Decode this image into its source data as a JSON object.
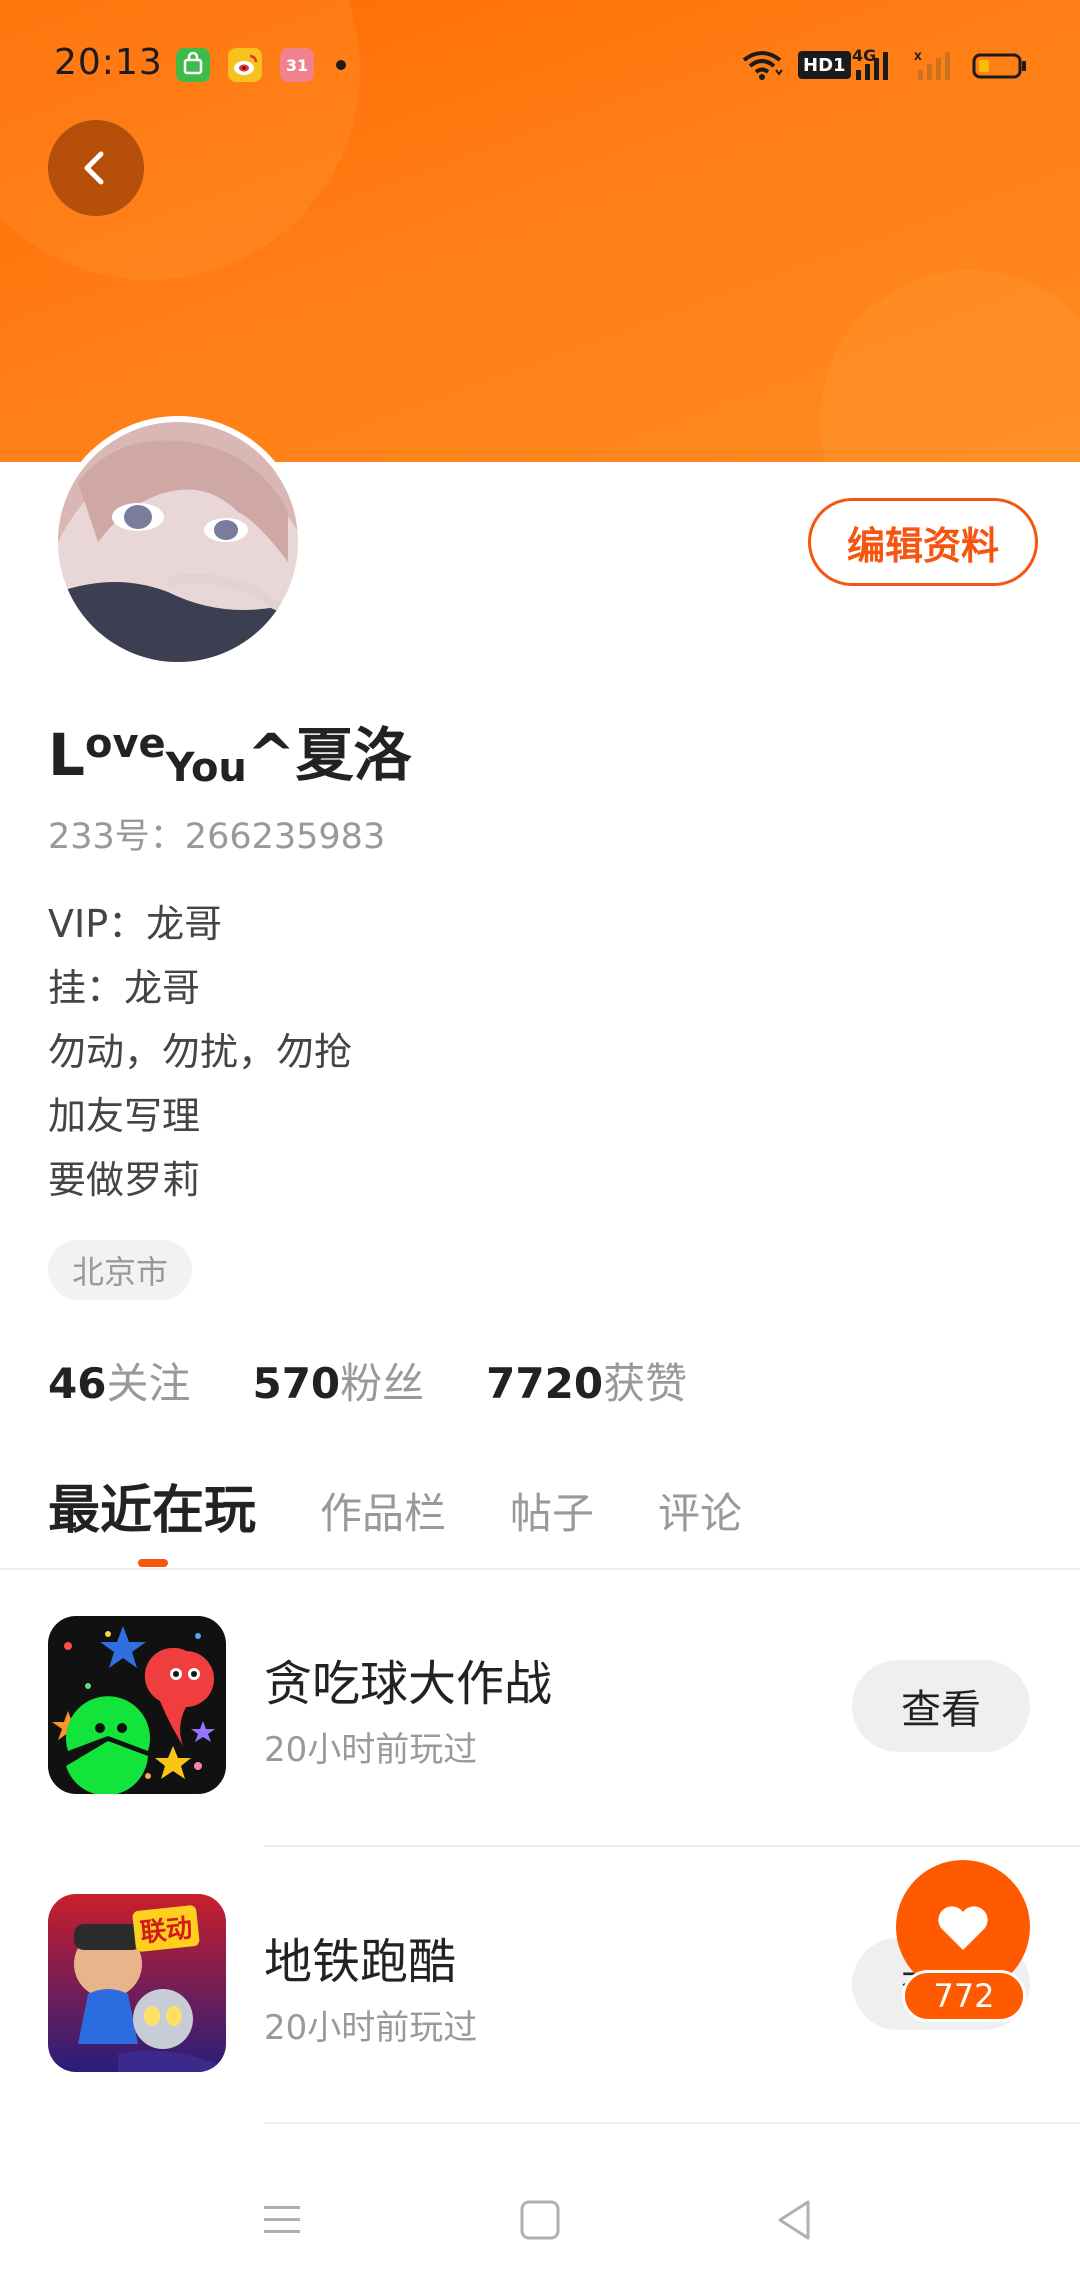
{
  "status_bar": {
    "time": "20:13",
    "app_icons": [
      "app-market-icon",
      "weibo-icon",
      "calendar-icon"
    ],
    "calendar_day": "31",
    "network_label": "4G",
    "hd_label": "HD1"
  },
  "colors": {
    "accent": "#f5550f",
    "header_gradient_start": "#ff6a00",
    "header_gradient_end": "#ff8a1f"
  },
  "profile": {
    "username_L": "L",
    "username_ove": "ove",
    "username_you": "You",
    "username_rest": "^夏洛",
    "id_text": "233号：266235983",
    "edit_button": "编辑资料",
    "bio": [
      "VIP：龙哥",
      "挂：龙哥",
      "勿动，勿扰，勿抢",
      "加友写理",
      "要做罗莉"
    ],
    "location": "北京市"
  },
  "stats": [
    {
      "num": "46",
      "label": "关注"
    },
    {
      "num": "570",
      "label": "粉丝"
    },
    {
      "num": "7720",
      "label": "获赞"
    }
  ],
  "tabs": [
    "最近在玩",
    "作品栏",
    "帖子",
    "评论"
  ],
  "games": [
    {
      "title": "贪吃球大作战",
      "subtitle": "20小时前玩过",
      "action": "查看"
    },
    {
      "title": "地铁跑酷",
      "subtitle": "20小时前玩过",
      "action": "查看",
      "badge": "联动"
    }
  ],
  "like_fab": {
    "count": "772"
  }
}
